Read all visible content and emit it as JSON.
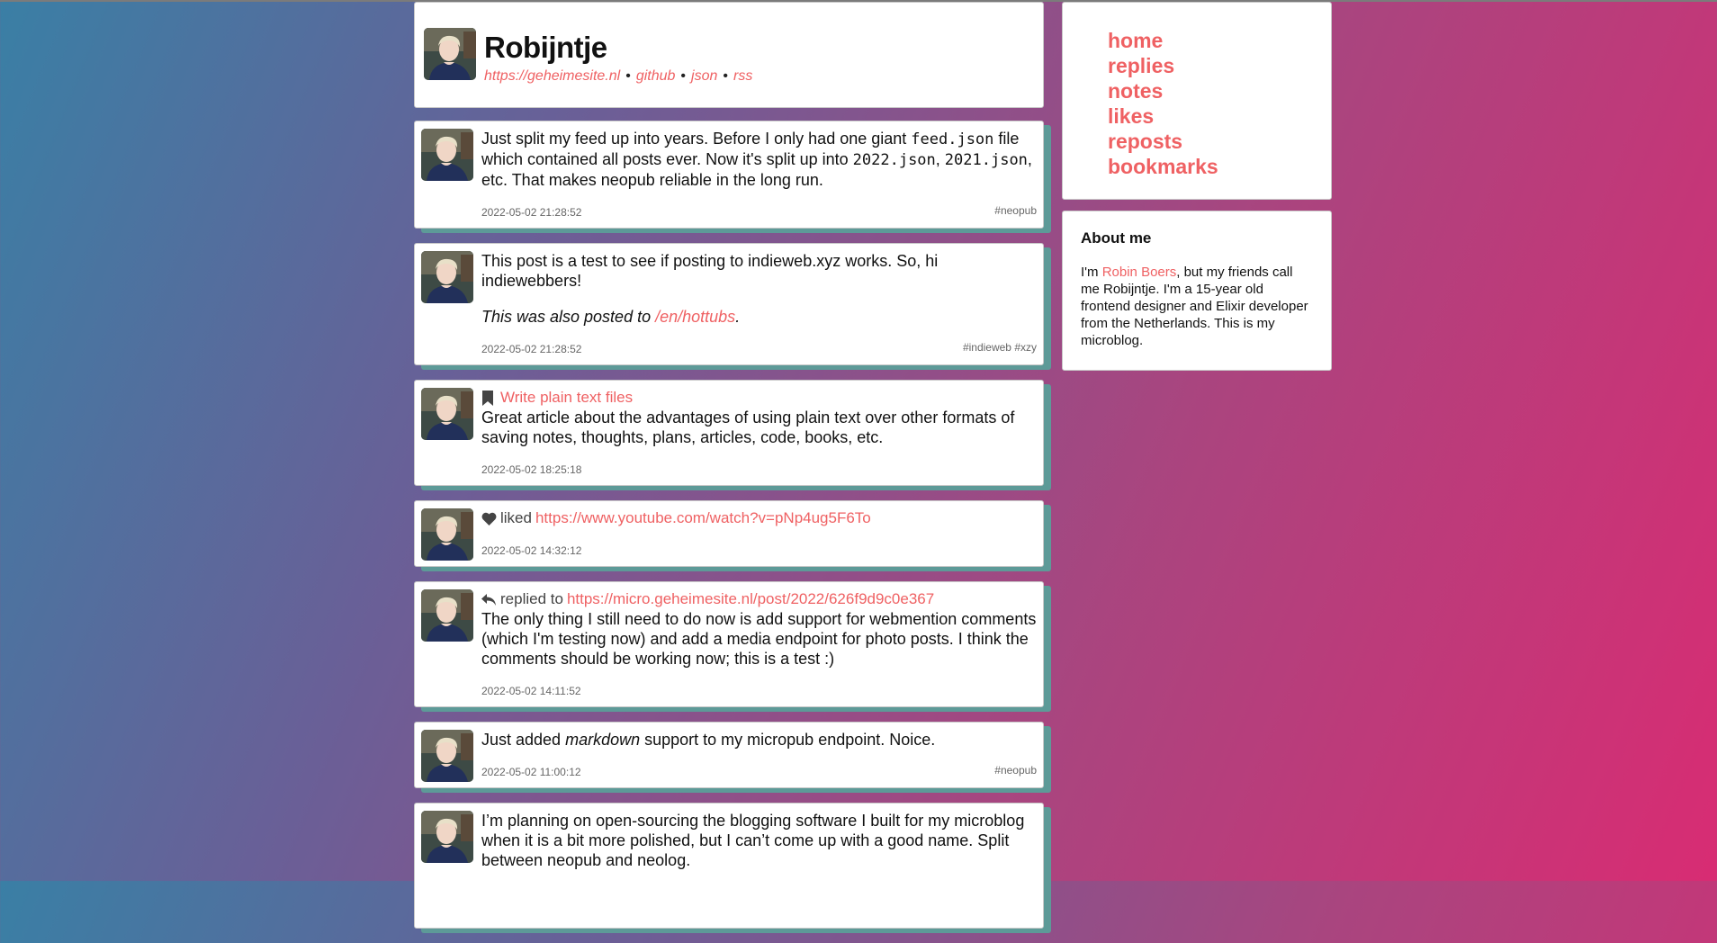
{
  "profile": {
    "name": "Robijntje",
    "links": [
      {
        "label": "https://geheimesite.nl"
      },
      {
        "label": "github"
      },
      {
        "label": "json"
      },
      {
        "label": "rss"
      }
    ],
    "separator": "•"
  },
  "nav": {
    "items": [
      {
        "label": "home"
      },
      {
        "label": "replies"
      },
      {
        "label": "notes"
      },
      {
        "label": "likes"
      },
      {
        "label": "reposts"
      },
      {
        "label": "bookmarks"
      }
    ]
  },
  "about": {
    "title": "About me",
    "text_before": "I'm ",
    "link": "Robin Boers",
    "text_after": ", but my friends call me Robijntje. I'm a 15-year old frontend designer and Elixir developer from the Netherlands. This is my microblog."
  },
  "posts": [
    {
      "t1": "Just split my feed up into years. Before I only had one giant ",
      "code1": "feed.json",
      "t2": " file which contained all posts ever. Now it's split up into ",
      "code2": "2022.json",
      "t3": ", ",
      "code3": "2021.json",
      "t4": ", etc. That makes neopub reliable in the long run.",
      "date": "2022-05-02 21:28:52",
      "tags": "#neopub"
    },
    {
      "text": "This post is a test to see if posting to indieweb.xyz works. So, hi indiewebbers!",
      "also_prefix": "This was also posted to ",
      "also_link": "/en/hottubs",
      "also_suffix": ".",
      "date": "2022-05-02 21:28:52",
      "tags": "#indieweb #xzy"
    },
    {
      "bookmark_title": "Write plain text files",
      "text": "Great article about the advantages of using plain text over other formats of saving notes, thoughts, plans, articles, code, books, etc.",
      "date": "2022-05-02 18:25:18"
    },
    {
      "action": "liked",
      "url": "https://www.youtube.com/watch?v=pNp4ug5F6To",
      "date": "2022-05-02 14:32:12"
    },
    {
      "action": "replied to",
      "url": "https://micro.geheimesite.nl/post/2022/626f9d9c0e367",
      "text": "The only thing I still need to do now is add support for webmention comments (which I'm testing now) and add a media endpoint for photo posts. I think the comments should be working now; this is a test :)",
      "date": "2022-05-02 14:11:52"
    },
    {
      "t1": "Just added ",
      "em": "markdown",
      "t2": " support to my micropub endpoint. Noice.",
      "date": "2022-05-02 11:00:12",
      "tags": "#neopub"
    },
    {
      "text": "I’m planning on open-sourcing the blogging software I built for my microblog when it is a bit more polished, but I can’t come up with a good name. Split between neopub and neolog."
    }
  ],
  "colors": {
    "accent": "#ef6163",
    "card_shadow": "#5d9a98",
    "bg_start": "#3a7fa5",
    "bg_end": "#d82c73"
  },
  "icons": {
    "bookmark": "bookmark-icon",
    "like": "heart-icon",
    "reply": "reply-icon"
  }
}
